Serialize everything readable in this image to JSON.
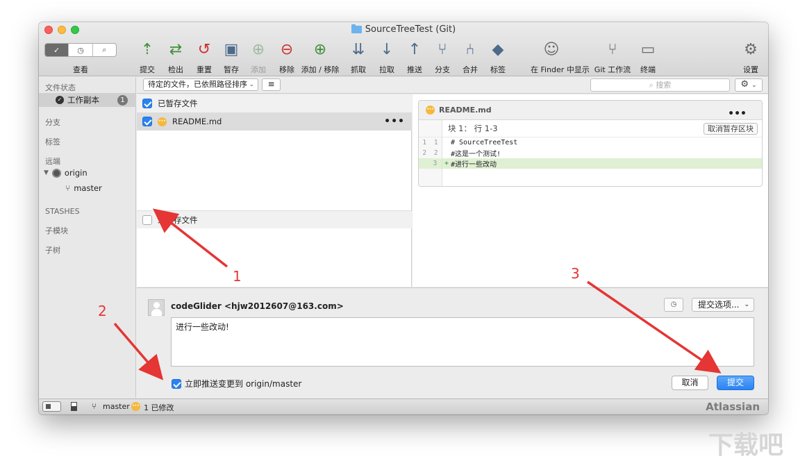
{
  "window": {
    "title": "SourceTreeTest (Git)"
  },
  "toolbar": {
    "view_label": "查看",
    "view_segments": [
      "✓",
      "◷",
      "⌕"
    ],
    "tools": [
      {
        "name": "commit",
        "label": "提交",
        "glyph": "⇡",
        "color": "#3f8f3a",
        "disabled": false
      },
      {
        "name": "checkout",
        "label": "检出",
        "glyph": "⇄",
        "color": "#3f8f3a",
        "disabled": false
      },
      {
        "name": "reset",
        "label": "重置",
        "glyph": "↺",
        "color": "#cc2f2f",
        "disabled": false
      },
      {
        "name": "stash",
        "label": "暂存",
        "glyph": "▣",
        "color": "#4e6a8a",
        "disabled": false
      },
      {
        "name": "add",
        "label": "添加",
        "glyph": "⊕",
        "color": "#9fb89f",
        "disabled": true
      },
      {
        "name": "remove",
        "label": "移除",
        "glyph": "⊖",
        "color": "#cc2f2f",
        "disabled": false
      },
      {
        "name": "add-remove",
        "label": "添加 / 移除",
        "glyph": "⊕",
        "color": "#3f8f3a",
        "disabled": false
      },
      {
        "name": "fetch",
        "label": "抓取",
        "glyph": "⇊",
        "color": "#4e6a8a",
        "disabled": false
      },
      {
        "name": "pull",
        "label": "拉取",
        "glyph": "↓",
        "color": "#4e6a8a",
        "disabled": false
      },
      {
        "name": "push",
        "label": "推送",
        "glyph": "↑",
        "color": "#4e6a8a",
        "disabled": false
      },
      {
        "name": "branch",
        "label": "分支",
        "glyph": "⑂",
        "color": "#4e6a8a",
        "disabled": false
      },
      {
        "name": "merge",
        "label": "合并",
        "glyph": "⑃",
        "color": "#4e6a8a",
        "disabled": false
      },
      {
        "name": "tag",
        "label": "标签",
        "glyph": "◆",
        "color": "#4e6a8a",
        "disabled": false
      },
      {
        "name": "show-in-finder",
        "label": "在 Finder 中显示",
        "glyph": "☺",
        "color": "#6a6a6a",
        "disabled": false
      },
      {
        "name": "git-flow",
        "label": "Git 工作流",
        "glyph": "⑂",
        "color": "#6a6a6a",
        "disabled": false
      },
      {
        "name": "terminal",
        "label": "终端",
        "glyph": "▭",
        "color": "#6a6a6a",
        "disabled": false
      },
      {
        "name": "settings",
        "label": "设置",
        "glyph": "⚙",
        "color": "#6a6a6a",
        "disabled": false
      }
    ]
  },
  "sidebar": {
    "file_status": "文件状态",
    "working_copy": "工作副本",
    "working_copy_count": "1",
    "branches": "分支",
    "tags": "标签",
    "remotes": "远端",
    "remote_name": "origin",
    "remote_branch": "master",
    "stashes": "STASHES",
    "submodules": "子模块",
    "subtrees": "子树"
  },
  "filebar": {
    "sort": "待定的文件，已依照路径排序",
    "search_placeholder": "搜索"
  },
  "staged": {
    "header": "已暂存文件",
    "file": "README.md",
    "more": "•••"
  },
  "unstaged": {
    "header": "未暂存文件"
  },
  "diff": {
    "file": "README.md",
    "more": "•••",
    "hunk": "块 1： 行 1-3",
    "unstage_hunk": "取消暂存区块",
    "lines": [
      {
        "old": "1",
        "new": "1",
        "sign": "",
        "text": "# SourceTreeTest",
        "added": false
      },
      {
        "old": "2",
        "new": "2",
        "sign": "",
        "text": "#这是一个测试!",
        "added": false
      },
      {
        "old": "",
        "new": "3",
        "sign": "+",
        "text": "#进行一些改动",
        "added": true
      }
    ]
  },
  "commit": {
    "author": "codeGlider <hjw2012607@163.com>",
    "options": "提交选项...",
    "message": "进行一些改动!",
    "push_immediately": "立即推送变更到 origin/master",
    "cancel": "取消",
    "submit": "提交"
  },
  "status": {
    "branch": "master",
    "changes": "1 已修改",
    "brand": "Atlassian"
  },
  "annotations": [
    "1",
    "2",
    "3"
  ],
  "colors": {
    "accent": "#2b83f0",
    "annotation": "#e53535",
    "added_line": "#dff0d3",
    "modified_badge": "#f5b83d"
  }
}
